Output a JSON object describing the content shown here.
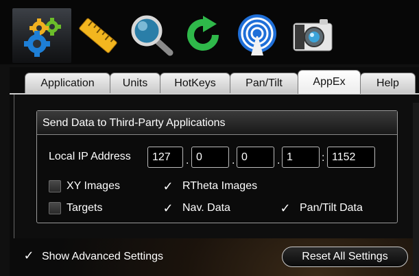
{
  "toolbar": {
    "tools": [
      {
        "icon": "gears-icon",
        "selected": true
      },
      {
        "icon": "ruler-icon",
        "selected": false
      },
      {
        "icon": "magnifier-icon",
        "selected": false
      },
      {
        "icon": "refresh-icon",
        "selected": false
      },
      {
        "icon": "broadcast-icon",
        "selected": false
      },
      {
        "icon": "camera-icon",
        "selected": false
      }
    ]
  },
  "tabs": [
    "Application",
    "Units",
    "HotKeys",
    "Pan/Tilt",
    "AppEx",
    "Help"
  ],
  "active_tab": "AppEx",
  "group": {
    "title": "Send Data to Third-Party Applications",
    "ip_label": "Local IP Address",
    "ip": [
      "127",
      "0",
      "0",
      "1"
    ],
    "port": "1152",
    "options": {
      "xy_images": {
        "label": "XY Images",
        "checked": false
      },
      "rtheta_images": {
        "label": "RTheta Images",
        "checked": true
      },
      "targets": {
        "label": "Targets",
        "checked": false
      },
      "nav_data": {
        "label": "Nav. Data",
        "checked": true
      },
      "pantilt_data": {
        "label": "Pan/Tilt Data",
        "checked": true
      }
    }
  },
  "footer": {
    "show_advanced": {
      "label": "Show Advanced Settings",
      "checked": true
    },
    "reset_label": "Reset All Settings"
  },
  "colors": {
    "accent_blue": "#1e7fd6",
    "accent_green": "#27b34a",
    "accent_yellow": "#f2b020"
  }
}
